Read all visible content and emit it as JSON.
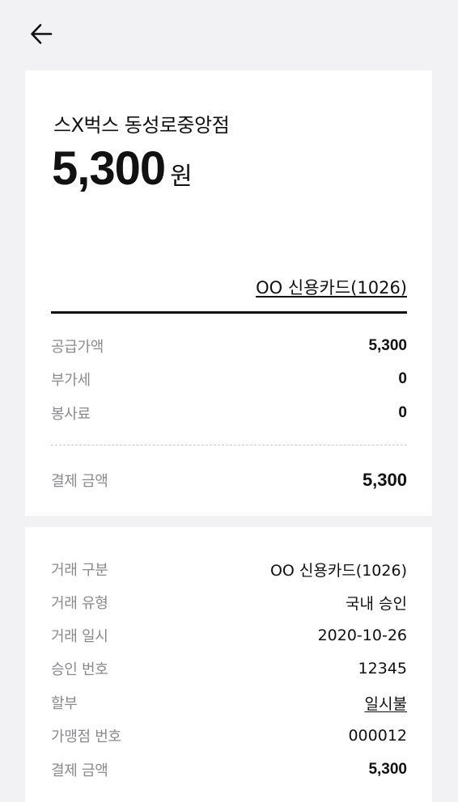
{
  "header": {
    "back_icon": "arrow-left-icon"
  },
  "receipt": {
    "merchant_name": "스X벅스 동성로중앙점",
    "amount": "5,300",
    "currency_unit": "원",
    "payment_method": "OO 신용카드(1026)",
    "breakdown": [
      {
        "label": "공급가액",
        "value": "5,300"
      },
      {
        "label": "부가세",
        "value": "0"
      },
      {
        "label": "봉사료",
        "value": "0"
      }
    ],
    "total_label": "결제 금액",
    "total_value": "5,300"
  },
  "details": {
    "rows": [
      {
        "label": "거래 구분",
        "value": "OO 신용카드(1026)"
      },
      {
        "label": "거래 유형",
        "value": "국내 승인"
      },
      {
        "label": "거래 일시",
        "value": "2020-10-26"
      },
      {
        "label": "승인 번호",
        "value": "12345"
      },
      {
        "label": "할부",
        "value": "일시불"
      },
      {
        "label": "가맹점 번호",
        "value": "000012"
      },
      {
        "label": "결제 금액",
        "value": "5,300"
      }
    ]
  },
  "colors": {
    "background": "#f2f2f4",
    "card": "#ffffff",
    "label": "#8a8a8e",
    "text": "#111111"
  }
}
